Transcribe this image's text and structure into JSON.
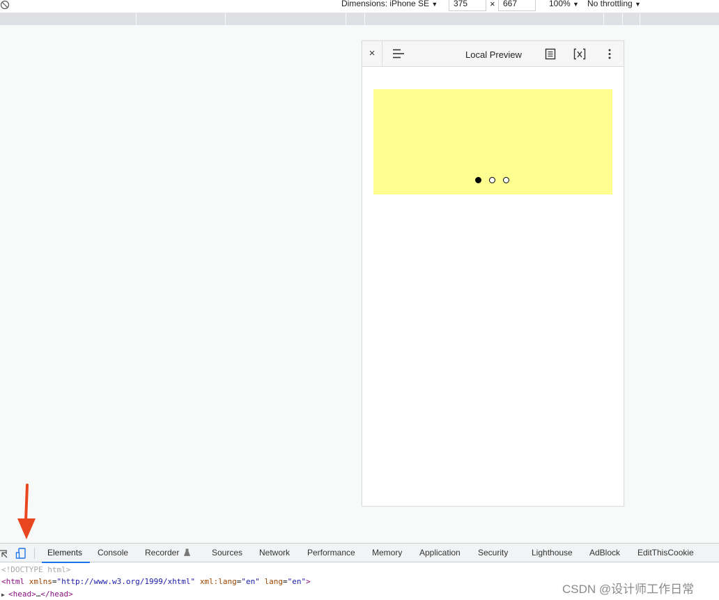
{
  "device_toolbar": {
    "dimensions_label": "Dimensions: iPhone SE",
    "width_value": "375",
    "times": "×",
    "height_value": "667",
    "zoom": "100%",
    "throttling": "No throttling",
    "dropdown_arrow": "▼"
  },
  "phone": {
    "close_label": "×",
    "title": "Local Preview",
    "swiper": {
      "background": "#ffff91",
      "slide_count": 3,
      "active_index": 0
    }
  },
  "devtools": {
    "tabs": [
      "Elements",
      "Console",
      "Recorder",
      "Sources",
      "Network",
      "Performance",
      "Memory",
      "Application",
      "Security",
      "Lighthouse",
      "AdBlock",
      "EditThisCookie"
    ],
    "active_tab": "Elements",
    "code": {
      "doctype": "<!DOCTYPE html>",
      "html_open": "<html",
      "attr_xmlns": "xmlns",
      "val_xmlns": "\"http://www.w3.org/1999/xhtml\"",
      "attr_xmllang": "xml:lang",
      "val_xmllang": "\"en\"",
      "attr_lang": "lang",
      "val_lang": "\"en\"",
      "html_close_bracket": ">",
      "head_open": "<head>",
      "ellipsis": "…",
      "head_close": "</head>"
    }
  },
  "colors": {
    "accent": "#1a73e8",
    "arrow": "#e8461e"
  },
  "watermark": "CSDN @设计师工作日常"
}
